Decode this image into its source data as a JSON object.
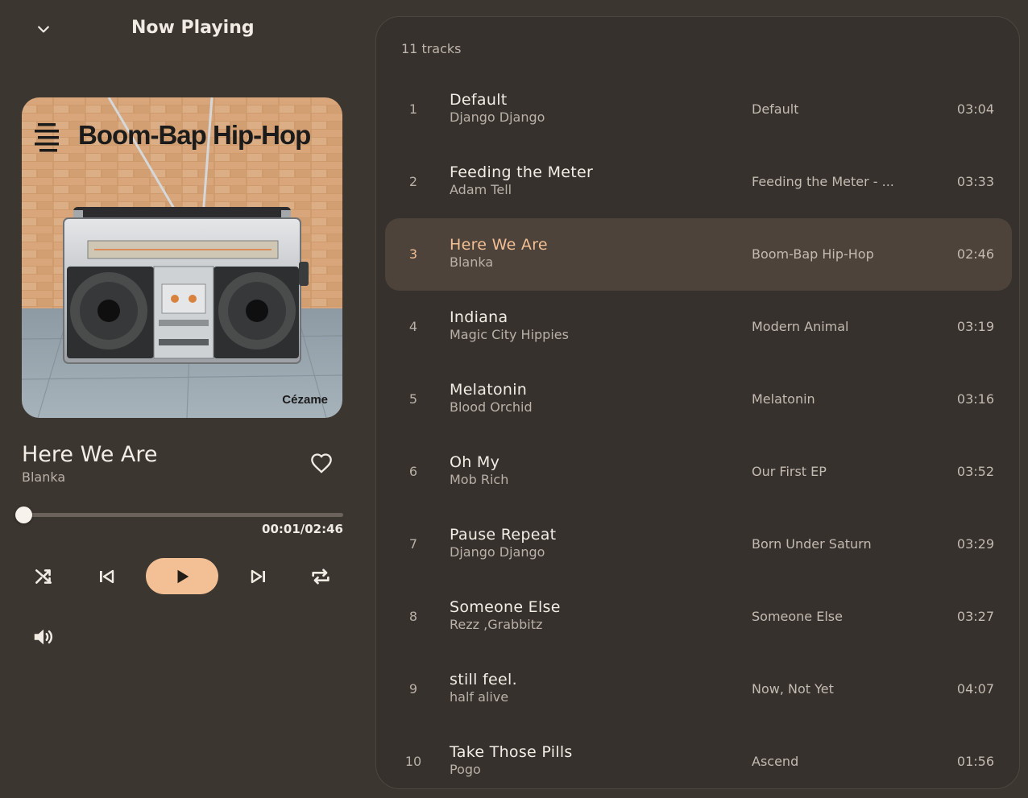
{
  "header": {
    "title": "Now Playing",
    "collapse_icon": "chevron-down-icon"
  },
  "cover": {
    "title_text": "Boom-Bap Hip-Hop",
    "label_text": "Cézame",
    "logo_icon": "label-logo-icon"
  },
  "now_playing": {
    "title": "Here We Are",
    "artist": "Blanka",
    "favorite_icon": "heart-outline-icon",
    "progress_fraction": 0.006,
    "time": "00:01/02:46"
  },
  "controls": {
    "shuffle_icon": "shuffle-icon",
    "previous_icon": "skip-previous-icon",
    "play_icon": "play-icon",
    "next_icon": "skip-next-icon",
    "repeat_icon": "repeat-icon",
    "volume_icon": "volume-icon"
  },
  "colors": {
    "accent": "#f3bf94",
    "background": "#3c3631",
    "panel": "#37312d",
    "active_row": "#4d433b"
  },
  "tracklist": {
    "count_label": "11 tracks",
    "active_index": 2,
    "tracks": [
      {
        "num": "1",
        "title": "Default",
        "artist": "Django Django",
        "album": "Default",
        "duration": "03:04"
      },
      {
        "num": "2",
        "title": "Feeding the Meter",
        "artist": "Adam Tell",
        "album": "Feeding the Meter - ...",
        "duration": "03:33"
      },
      {
        "num": "3",
        "title": "Here We Are",
        "artist": "Blanka",
        "album": "Boom-Bap Hip-Hop",
        "duration": "02:46"
      },
      {
        "num": "4",
        "title": "Indiana",
        "artist": "Magic City Hippies",
        "album": "Modern Animal",
        "duration": "03:19"
      },
      {
        "num": "5",
        "title": "Melatonin",
        "artist": "Blood Orchid",
        "album": "Melatonin",
        "duration": "03:16"
      },
      {
        "num": "6",
        "title": "Oh My",
        "artist": "Mob Rich",
        "album": "Our First EP",
        "duration": "03:52"
      },
      {
        "num": "7",
        "title": "Pause Repeat",
        "artist": "Django Django",
        "album": "Born Under Saturn",
        "duration": "03:29"
      },
      {
        "num": "8",
        "title": "Someone Else",
        "artist": "Rezz ,Grabbitz",
        "album": "Someone Else",
        "duration": "03:27"
      },
      {
        "num": "9",
        "title": "still feel.",
        "artist": "half alive",
        "album": "Now, Not Yet",
        "duration": "04:07"
      },
      {
        "num": "10",
        "title": "Take Those Pills",
        "artist": "Pogo",
        "album": "Ascend",
        "duration": "01:56"
      }
    ]
  }
}
